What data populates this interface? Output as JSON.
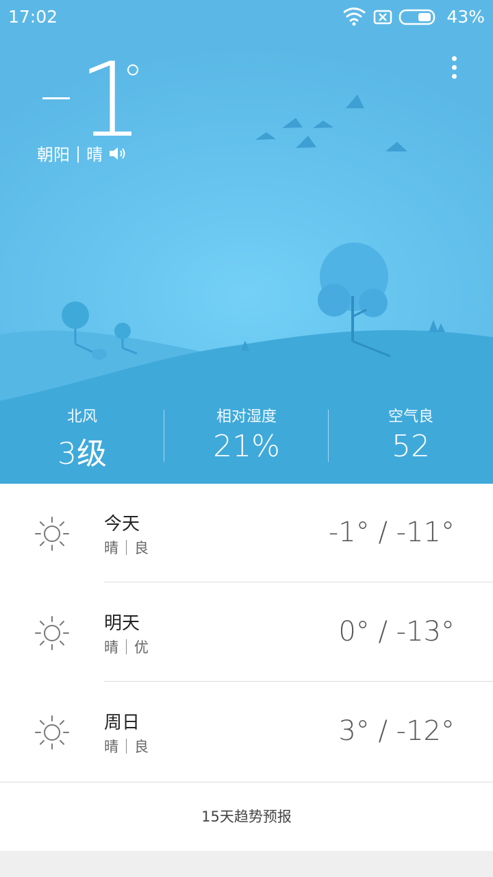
{
  "status_bar": {
    "time": "17:02",
    "battery_percent": "43%"
  },
  "current": {
    "temperature_sign": "-",
    "temperature_value": "1",
    "location": "朝阳",
    "separator": "|",
    "condition": "晴"
  },
  "stats": [
    {
      "label": "北风",
      "value": "3级"
    },
    {
      "label": "相对湿度",
      "value": "21%"
    },
    {
      "label": "空气良",
      "value": "52"
    }
  ],
  "forecast": [
    {
      "day": "今天",
      "weather": "晴",
      "air": "良",
      "range": "-1° / -11°"
    },
    {
      "day": "明天",
      "weather": "晴",
      "air": "优",
      "range": "0° / -13°"
    },
    {
      "day": "周日",
      "weather": "晴",
      "air": "良",
      "range": "3° / -12°"
    }
  ],
  "forecast_15_label": "15天趋势预报",
  "colors": {
    "sky": "#66c4ee",
    "hill_front": "#3fa9da",
    "tree": "#4fb3e6",
    "bird": "#3fa0d4"
  }
}
